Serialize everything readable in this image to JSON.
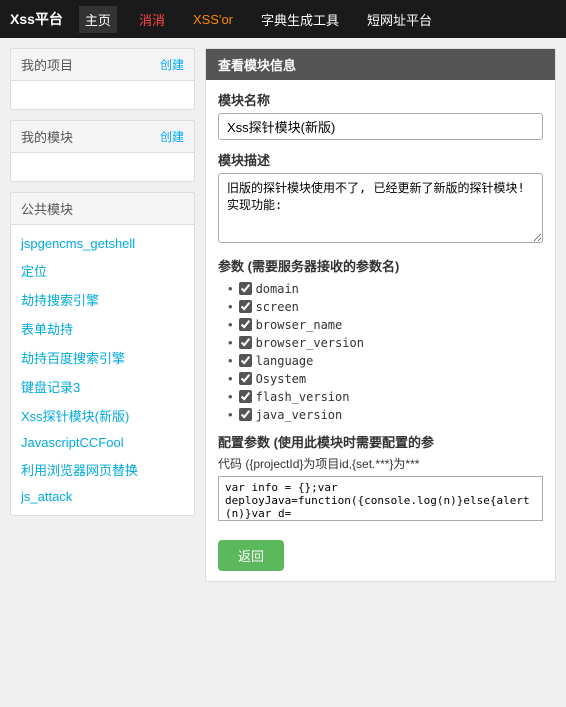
{
  "navbar": {
    "brand": "Xss平台",
    "items": [
      {
        "label": "主页",
        "class": "active",
        "name": "home"
      },
      {
        "label": "消消",
        "class": "red",
        "name": "xiaoxiao"
      },
      {
        "label": "XSS'or",
        "class": "orange",
        "name": "xssor"
      },
      {
        "label": "字典生成工具",
        "class": "",
        "name": "dict"
      },
      {
        "label": "短网址平台",
        "class": "",
        "name": "shorturl"
      }
    ]
  },
  "sidebar": {
    "my_projects": {
      "title": "我的项目",
      "action": "创建"
    },
    "my_modules": {
      "title": "我的模块",
      "action": "创建"
    },
    "public_modules": {
      "title": "公共模块",
      "items": [
        "jspgencms_getshell",
        "定位",
        "劫持搜索引擎",
        "表单劫持",
        "劫持百度搜索引擎",
        "键盘记录3",
        "Xss探针模块(新版)",
        "JavascriptCCFool",
        "利用浏览器网页替换",
        "js_attack"
      ]
    }
  },
  "right_panel": {
    "header": "查看模块信息",
    "module_name_label": "模块名称",
    "module_name_value": "Xss探针模块(新版)",
    "module_desc_label": "模块描述",
    "module_desc_value": "旧版的探针模块使用不了, 已经更新了新版的探针模块!\n实现功能:",
    "params_label": "参数 (需要服务器接收的参数名)",
    "params": [
      {
        "name": "domain",
        "checked": true
      },
      {
        "name": "screen",
        "checked": true
      },
      {
        "name": "browser_name",
        "checked": true
      },
      {
        "name": "browser_version",
        "checked": true
      },
      {
        "name": "language",
        "checked": true
      },
      {
        "name": "Osystem",
        "checked": true
      },
      {
        "name": "flash_version",
        "checked": true
      },
      {
        "name": "java_version",
        "checked": true
      }
    ],
    "config_label": "配置参数 (使用此模块时需要配置的参",
    "code_label": "代码 ({projectId}为项目id,{set.***}为***",
    "code_value": "var info = {};var deployJava=function({console.log(n)}else{alert(n)}var d=",
    "return_button": "返回"
  }
}
